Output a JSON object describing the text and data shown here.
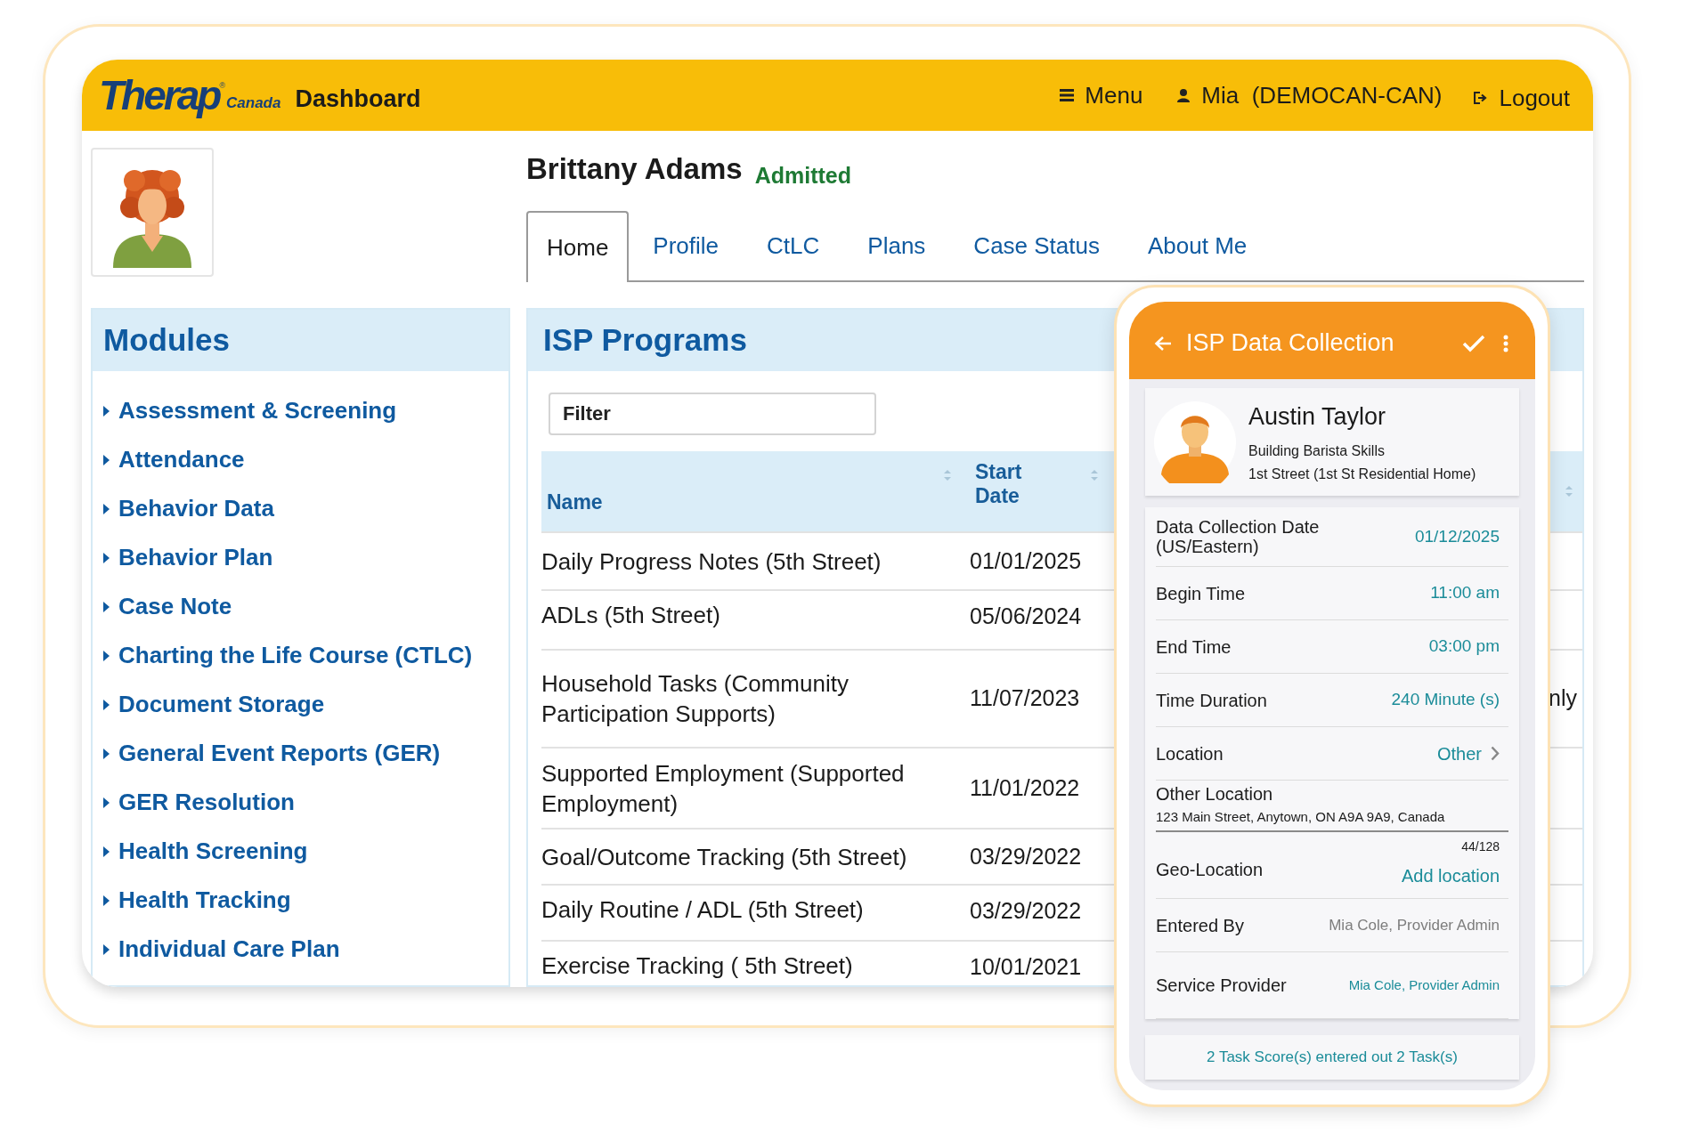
{
  "header": {
    "logo": {
      "text": "Therap",
      "mark": "®",
      "region": "Canada"
    },
    "title": "Dashboard",
    "menu": "Menu",
    "user": "Mia  (DEMOCAN-CAN)",
    "logout": "Logout"
  },
  "client": {
    "name": "Brittany Adams",
    "status": "Admitted"
  },
  "tabs": [
    {
      "label": "Home",
      "selected": true
    },
    {
      "label": "Profile",
      "selected": false
    },
    {
      "label": "CtLC",
      "selected": false
    },
    {
      "label": "Plans",
      "selected": false
    },
    {
      "label": "Case Status",
      "selected": false
    },
    {
      "label": "About Me",
      "selected": false
    }
  ],
  "modules": {
    "title": "Modules",
    "items": [
      "Assessment & Screening",
      "Attendance",
      "Behavior Data",
      "Behavior Plan",
      "Case Note",
      "Charting the Life Course (CTLC)",
      "Document Storage",
      "General Event Reports (GER)",
      "GER Resolution",
      "Health Screening",
      "Health Tracking",
      "Individual Care Plan"
    ]
  },
  "programs": {
    "title": "ISP Programs",
    "filter": {
      "placeholder": "Filter"
    },
    "columns": [
      "Name",
      "Start Date"
    ],
    "rows": [
      {
        "name": "Daily Progress Notes (5th Street)",
        "start_date": "01/01/2025"
      },
      {
        "name": "ADLs (5th Street)",
        "start_date": "05/06/2024"
      },
      {
        "name": "Household Tasks (Community Participation Supports)",
        "start_date": "11/07/2023",
        "column_3": "nly"
      },
      {
        "name": "Supported Employment (Supported Employment)",
        "start_date": "11/01/2022"
      },
      {
        "name": "Goal/Outcome Tracking (5th Street)",
        "start_date": "03/29/2022"
      },
      {
        "name": "Daily Routine / ADL (5th Street)",
        "start_date": "03/29/2022"
      },
      {
        "name": "Exercise Tracking ( 5th Street)",
        "start_date": "10/01/2021"
      }
    ]
  },
  "data_collection": {
    "title": "ISP Data Collection",
    "person": {
      "name": "Austin Taylor",
      "program": "Building Barista Skills",
      "location": "1st Street (1st St Residential Home)"
    },
    "fields": [
      {
        "kind": "value",
        "label": "Data Collection Date (US/Eastern)",
        "value": "01/12/2025"
      },
      {
        "kind": "value",
        "label": "Begin Time",
        "value": "11:00 am"
      },
      {
        "kind": "value",
        "label": "End Time",
        "value": "03:00 pm"
      },
      {
        "kind": "value",
        "label": "Time Duration",
        "value": "240 Minute (s)"
      },
      {
        "kind": "select",
        "label": "Location",
        "value": "Other"
      },
      {
        "kind": "input",
        "label": "Other Location",
        "value": "123 Main Street, Anytown, ON A9A 9A9, Canada",
        "counter": "44/128"
      },
      {
        "kind": "action",
        "label": "Geo-Location",
        "value": "Add location"
      },
      {
        "kind": "readonly",
        "label": "Entered By",
        "value": "Mia Cole, Provider Admin"
      },
      {
        "kind": "link",
        "label": "Service Provider",
        "value": "Mia Cole, Provider Admin"
      }
    ],
    "summary": "2 Task Score(s) entered out 2 Task(s)"
  }
}
